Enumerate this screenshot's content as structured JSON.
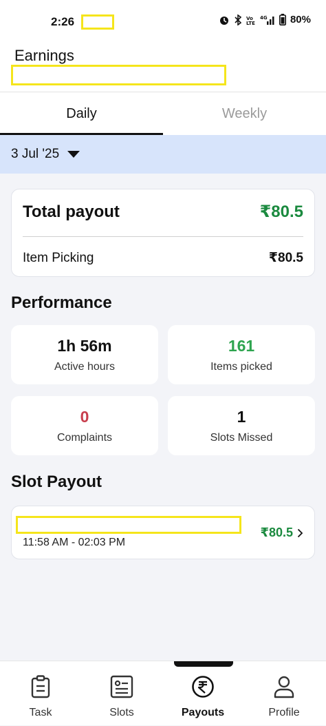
{
  "status_bar": {
    "time": "2:26",
    "battery": "80%"
  },
  "header": {
    "title": "Earnings"
  },
  "tabs": [
    {
      "label": "Daily",
      "active": true
    },
    {
      "label": "Weekly",
      "active": false
    }
  ],
  "date_selector": {
    "value": "3 Jul '25"
  },
  "payout": {
    "total_label": "Total payout",
    "total_amount": "₹80.5",
    "item_label": "Item Picking",
    "item_amount": "₹80.5"
  },
  "performance": {
    "title": "Performance",
    "stats": [
      {
        "value": "1h 56m",
        "label": "Active hours"
      },
      {
        "value": "161",
        "label": "Items picked"
      },
      {
        "value": "0",
        "label": "Complaints"
      },
      {
        "value": "1",
        "label": "Slots Missed"
      }
    ]
  },
  "slot_payout": {
    "title": "Slot Payout",
    "slots": [
      {
        "time": "11:58 AM - 02:03 PM",
        "amount": "₹80.5"
      }
    ]
  },
  "bottom_nav": [
    {
      "label": "Task",
      "icon": "clipboard-icon"
    },
    {
      "label": "Slots",
      "icon": "slot-card-icon"
    },
    {
      "label": "Payouts",
      "icon": "rupee-icon",
      "active": true
    },
    {
      "label": "Profile",
      "icon": "person-icon"
    }
  ],
  "colors": {
    "accent_green": "#1b8a3f",
    "date_bar_bg": "#d7e4fb",
    "complaints_red": "#c83e4d"
  }
}
